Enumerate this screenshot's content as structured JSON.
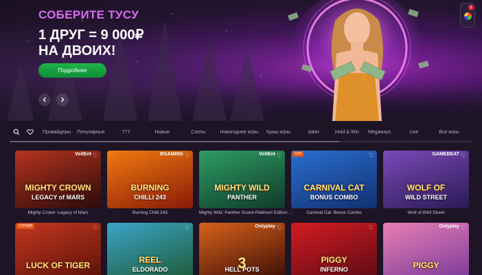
{
  "hero": {
    "title": "СОБЕРИТЕ ТУСУ",
    "line1": "1 ДРУГ = 9 000₽",
    "line2": "НА ДВОИХ!",
    "cta": "Подробнее",
    "prev_icon": "chevron-left-icon",
    "next_icon": "chevron-right-icon",
    "promo_count": "3"
  },
  "nav": {
    "search_icon": "search-icon",
    "favorites_icon": "heart-icon",
    "items": [
      "Провайдеры",
      "Популярные",
      "777",
      "Новые",
      "Слоты",
      "Новогодние игры",
      "Краш игры",
      "Joker",
      "Hold & Win",
      "Megaways",
      "Live",
      "Все игры"
    ]
  },
  "games": [
    {
      "name": "Mighty Crown: Legacy of Mars",
      "provider": "VoltEnt",
      "badge": "",
      "art_title": "MIGHTY CROWN",
      "art_sub": "LEGACY of MARS",
      "bg": "#b5331f",
      "bg2": "#2a0b0a"
    },
    {
      "name": "Burning Chilli 243",
      "provider": "BGAMING",
      "badge": "",
      "art_title": "BURNING",
      "art_sub": "CHILLI 243",
      "bg": "#f07a10",
      "bg2": "#8a1a08"
    },
    {
      "name": "Mighty Wild: Panther Grand Platinum Edition ...",
      "provider": "VoltEnt",
      "badge": "",
      "art_title": "MIGHTY WILD",
      "art_sub": "PANTHER",
      "bg": "#2f9d63",
      "bg2": "#0f3a2a"
    },
    {
      "name": "Carnival Cat: Bonus Combo",
      "provider": "",
      "badge": "ТОП",
      "art_title": "CARNIVAL CAT",
      "art_sub": "BONUS COMBO",
      "bg": "#2a6fd0",
      "bg2": "#123070"
    },
    {
      "name": "Wolf of Wild Street",
      "provider": "GAMEBEAT",
      "badge": "",
      "art_title": "WOLF OF",
      "art_sub": "WILD STREET",
      "bg": "#7a4ab8",
      "bg2": "#2b1a55"
    },
    {
      "name": "",
      "provider": "",
      "badge": "ТУРНИР",
      "art_title": "LUCK OF TIGER",
      "art_sub": "",
      "bg": "#c3361f",
      "bg2": "#5a1208"
    },
    {
      "name": "",
      "provider": "",
      "badge": "",
      "art_title": "REEL",
      "art_sub": "ELDORADO",
      "bg": "#3ba4c8",
      "bg2": "#1d5a34"
    },
    {
      "name": "",
      "provider": "Onlyplay",
      "badge": "",
      "art_title": "3",
      "art_sub": "HELL POTS",
      "bg": "#d8621a",
      "bg2": "#3a0c06"
    },
    {
      "name": "",
      "provider": "",
      "badge": "",
      "art_title": "PIGGY",
      "art_sub": "INFERNO",
      "bg": "#d41c22",
      "bg2": "#5a0a14"
    },
    {
      "name": "",
      "provider": "Onlyplay",
      "badge": "",
      "art_title": "PIGGY",
      "art_sub": "",
      "bg": "#e87fb5",
      "bg2": "#7a3a9a"
    }
  ]
}
